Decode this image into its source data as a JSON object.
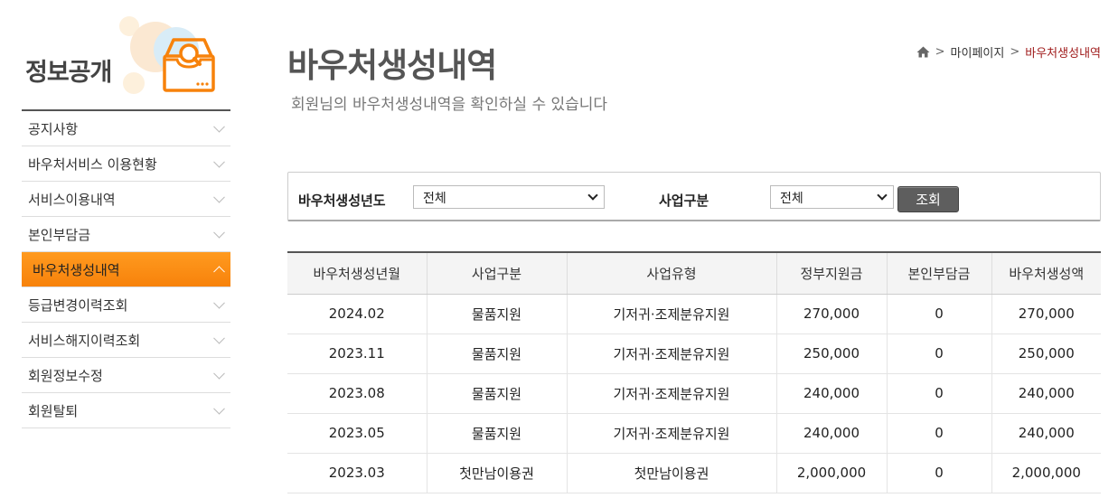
{
  "sidebar": {
    "title": "정보공개",
    "items": [
      {
        "label": "공지사항",
        "active": false
      },
      {
        "label": "바우처서비스 이용현황",
        "active": false
      },
      {
        "label": "서비스이용내역",
        "active": false
      },
      {
        "label": "본인부담금",
        "active": false
      },
      {
        "label": "바우처생성내역",
        "active": true
      },
      {
        "label": "등급변경이력조회",
        "active": false
      },
      {
        "label": "서비스해지이력조회",
        "active": false
      },
      {
        "label": "회원정보수정",
        "active": false
      },
      {
        "label": "회원탈퇴",
        "active": false
      }
    ]
  },
  "header": {
    "title": "바우처생성내역",
    "subtitle": "회원님의 바우처생성내역을 확인하실 수 있습니다",
    "breadcrumb": [
      "마이페이지",
      "바우처생성내역"
    ]
  },
  "search": {
    "year_label": "바우처생성년도",
    "year_value": "전체",
    "type_label": "사업구분",
    "type_value": "전체",
    "button_label": "조회"
  },
  "table": {
    "headers": [
      "바우처생성년월",
      "사업구분",
      "사업유형",
      "정부지원금",
      "본인부담금",
      "바우처생성액"
    ],
    "rows": [
      [
        "2024.02",
        "물품지원",
        "기저귀·조제분유지원",
        "270,000",
        "0",
        "270,000"
      ],
      [
        "2023.11",
        "물품지원",
        "기저귀·조제분유지원",
        "250,000",
        "0",
        "250,000"
      ],
      [
        "2023.08",
        "물품지원",
        "기저귀·조제분유지원",
        "240,000",
        "0",
        "240,000"
      ],
      [
        "2023.05",
        "물품지원",
        "기저귀·조제분유지원",
        "240,000",
        "0",
        "240,000"
      ],
      [
        "2023.03",
        "첫만남이용권",
        "첫만남이용권",
        "2,000,000",
        "0",
        "2,000,000"
      ]
    ]
  },
  "colors": {
    "accent": "#f7820b",
    "breadcrumb_current": "#a01c1c",
    "button": "#5e5e5e"
  }
}
